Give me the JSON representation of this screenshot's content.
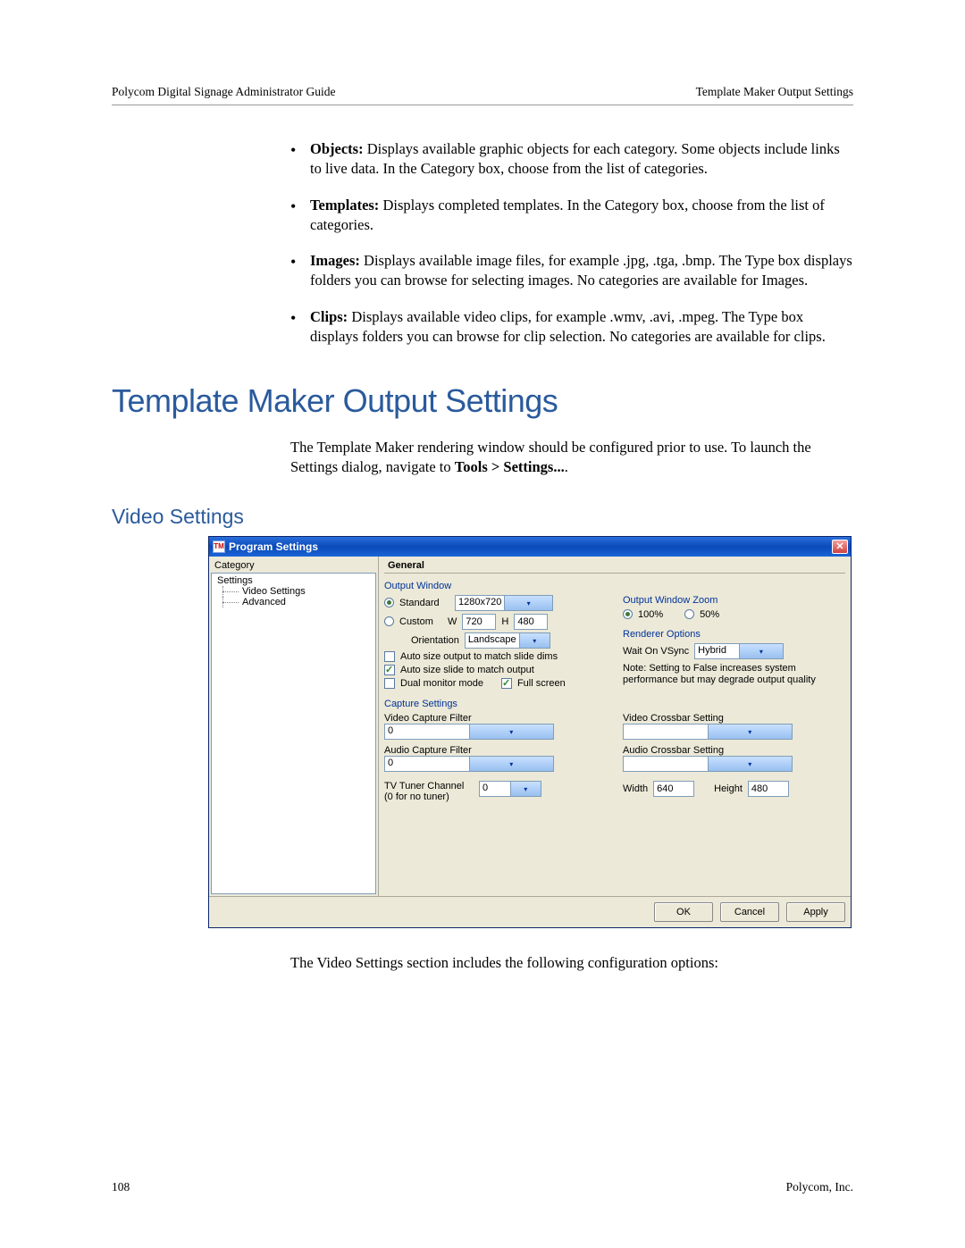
{
  "header": {
    "left": "Polycom Digital Signage Administrator Guide",
    "right": "Template Maker Output Settings"
  },
  "bullets": {
    "objects_label": "Objects:",
    "objects_text": " Displays available graphic objects for each category. Some objects include links to live data. In the Category box, choose from the list of categories.",
    "templates_label": "Templates:",
    "templates_text": " Displays completed templates. In the Category box, choose from the list of categories.",
    "images_label": "Images:",
    "images_text": " Displays available image files, for example .jpg, .tga, .bmp. The Type box displays folders you can browse for selecting images. No categories are available for Images.",
    "clips_label": "Clips:",
    "clips_text": " Displays available video clips, for example .wmv, .avi, .mpeg. The Type box displays folders you can browse for clip selection. No categories are available for clips."
  },
  "section_title": "Template Maker Output Settings",
  "section_body_a": "The Template Maker rendering window should be configured prior to use. To launch the Settings dialog, navigate to ",
  "section_body_bold": "Tools > Settings...",
  "section_body_b": ".",
  "subsection_title": "Video Settings",
  "dialog": {
    "title": "Program Settings",
    "category_label": "Category",
    "tree": {
      "root": "Settings",
      "item1": "Video Settings",
      "item2": "Advanced"
    },
    "general_label": "General",
    "output_window_label": "Output Window",
    "standard_label": "Standard",
    "resolution": "1280x720",
    "custom_label": "Custom",
    "w_label": "W",
    "w_value": "720",
    "h_label": "H",
    "h_value": "480",
    "orientation_label": "Orientation",
    "orientation_value": "Landscape",
    "auto_size_output": "Auto size output to match slide dims",
    "auto_size_slide": "Auto size slide to match output",
    "dual_monitor": "Dual monitor mode",
    "full_screen": "Full screen",
    "output_zoom_label": "Output Window Zoom",
    "zoom_100": "100%",
    "zoom_50": "50%",
    "renderer_options_label": "Renderer Options",
    "wait_vsync_label": "Wait On VSync",
    "wait_vsync_value": "Hybrid",
    "note_text": "Note: Setting to False increases system performance but may degrade output quality",
    "capture_settings_label": "Capture Settings",
    "video_capture_filter_label": "Video Capture Filter",
    "video_capture_filter_value": "0",
    "video_crossbar_label": "Video Crossbar Setting",
    "video_crossbar_value": "",
    "audio_capture_filter_label": "Audio Capture Filter",
    "audio_capture_filter_value": "0",
    "audio_crossbar_label": "Audio Crossbar Setting",
    "audio_crossbar_value": "",
    "tv_tuner_label": "TV Tuner Channel (0 for no tuner)",
    "tv_tuner_value": "0",
    "width_label": "Width",
    "width_value": "640",
    "height_label": "Height",
    "height_value": "480",
    "btn_ok": "OK",
    "btn_cancel": "Cancel",
    "btn_apply": "Apply"
  },
  "below_dialog": "The Video Settings section includes the following configuration options:",
  "footer": {
    "page": "108",
    "company": "Polycom, Inc."
  }
}
